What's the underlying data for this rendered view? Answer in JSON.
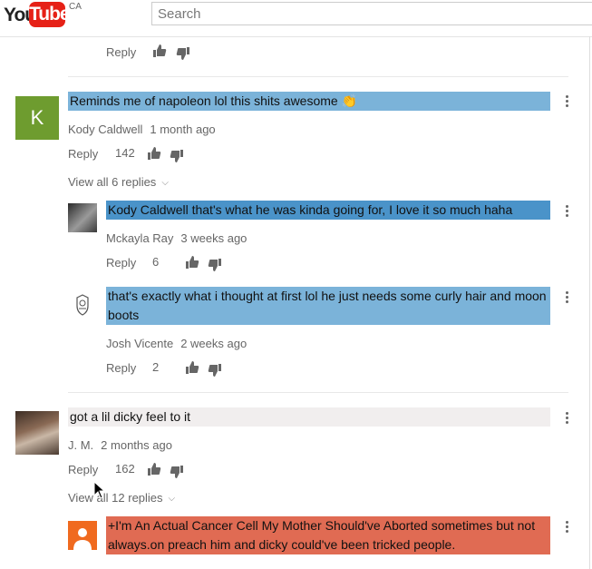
{
  "header": {
    "logo_you": "You",
    "logo_tube": "Tube",
    "logo_region": "CA",
    "search_placeholder": "Search"
  },
  "colors": {
    "highlight_blue_light": "#7bb3d9",
    "highlight_blue_dark": "#4a93c9",
    "highlight_grey": "#f1eeee",
    "highlight_red": "#e06b53",
    "avatar_green": "#6e9c2f",
    "avatar_orange": "#f06a1f"
  },
  "actions": {
    "reply_label": "Reply"
  },
  "comments": [
    {
      "author": "Kody Caldwell",
      "date": "1 month ago",
      "text": "Reminds me of napoleon lol this shits awesome 👏",
      "likes": "142",
      "avatar_letter": "K",
      "view_replies": "View all 6 replies",
      "replies": [
        {
          "author": "Mckayla Ray",
          "date": "3 weeks ago",
          "text": "Kody Caldwell that's what he was kinda going for, I love it so much haha",
          "likes": "6"
        },
        {
          "author": "Josh Vicente",
          "date": "2 weeks ago",
          "text": "that's exactly what i thought at first lol he just needs some curly hair and moon boots",
          "likes": "2"
        }
      ]
    },
    {
      "author": "J. M.",
      "date": "2 months ago",
      "text": "got a lil dicky feel to it",
      "likes": "162",
      "view_replies": "View all 12 replies",
      "replies": [
        {
          "text": "+I'm An Actual Cancer Cell My Mother Should've Aborted sometimes but not always.on preach him and dicky could've been tricked people."
        }
      ]
    }
  ]
}
